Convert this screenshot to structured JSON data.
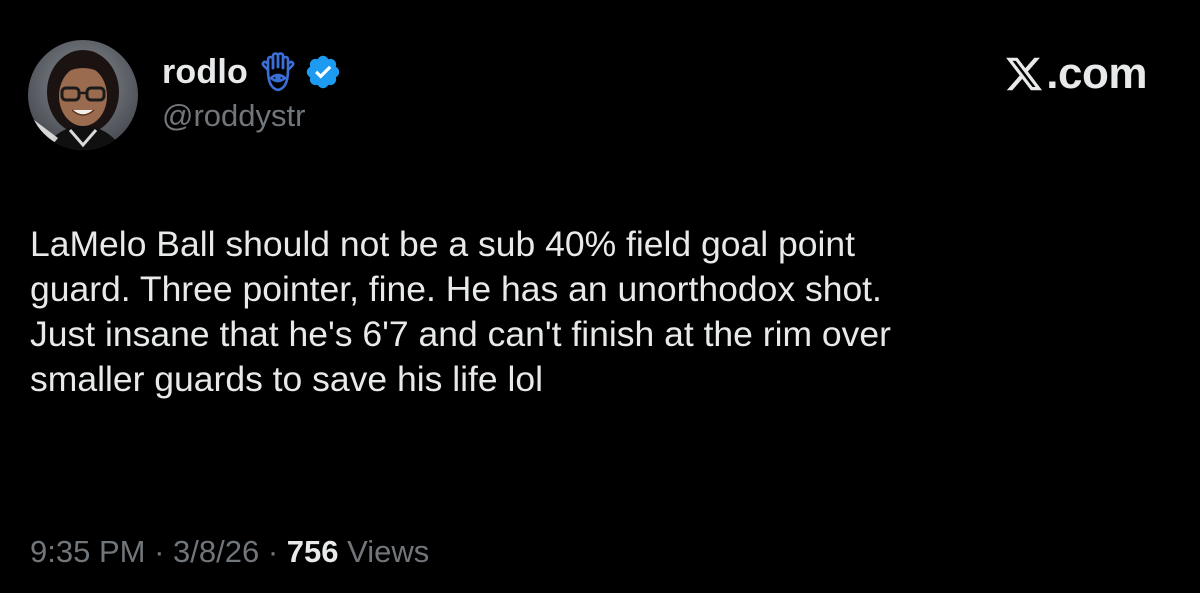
{
  "author": {
    "display_name": "rodlo",
    "handle": "@roddystr",
    "avatar": "avatar-photo",
    "badges": [
      "hamsa-icon",
      "verified-badge-icon"
    ]
  },
  "brand": {
    "text": ".com",
    "logo": "x-logo-icon"
  },
  "tweet": {
    "lines": [
      "LaMelo Ball should not be a sub 40% field goal point",
      "guard. Three pointer, fine. He has an unorthodox shot.",
      "Just insane that he's 6'7 and can't finish at the rim over",
      "smaller guards to save his life lol"
    ]
  },
  "meta": {
    "time": "9:35 PM",
    "separator_1": " · ",
    "date": "3/8/26",
    "separator_2": " · ",
    "views_count": "756",
    "views_label": " Views"
  },
  "colors": {
    "background": "#000000",
    "primary_text": "#e7e9ea",
    "secondary_text": "#71767b",
    "verified_blue": "#1d9bf0",
    "hamsa_blue": "#3b6fd8"
  }
}
